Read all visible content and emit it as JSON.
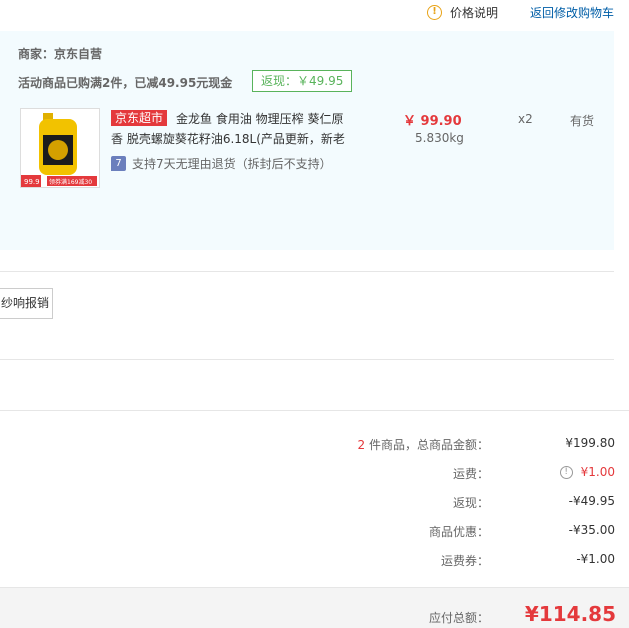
{
  "top_links": {
    "price_info": "价格说明",
    "return_cart": "返回修改购物车"
  },
  "shop": {
    "merchant": "商家：京东自营",
    "promo": "活动商品已购满2件，已减49.95元现金",
    "rebate_tag": "返现：￥49.95"
  },
  "product": {
    "badge": "京东超市",
    "title": "金龙鱼 食用油 物理压榨 葵仁原香 脱壳螺旋葵花籽油6.18L(产品更新，新老",
    "price": "￥ 99.90",
    "weight": "5.830kg",
    "qty": "x2",
    "stock": "有货",
    "return_icon": "7",
    "return_text": "支持7天无理由退货（拆封后不支持）",
    "thumb_price": "99.9",
    "thumb_promo": "领券满169减30"
  },
  "invoice": {
    "button": "纱响报销"
  },
  "summary": {
    "count": "2",
    "count_suffix": "件商品，总商品金额：",
    "total_goods": "¥199.80",
    "freight_label": "运费：",
    "freight_value": "¥1.00",
    "rebate_label": "返现：",
    "rebate_value": "-¥49.95",
    "discount_label": "商品优惠：",
    "discount_value": "-¥35.00",
    "freight_coupon_label": "运费券：",
    "freight_coupon_value": "-¥1.00",
    "payable_label": "应付总额：",
    "payable_value": "¥114.85"
  },
  "colors": {
    "accent_red": "#e4393c",
    "link_blue": "#005ea7",
    "rebate_green": "#59b35b",
    "shop_bg": "#f3fbfe"
  }
}
